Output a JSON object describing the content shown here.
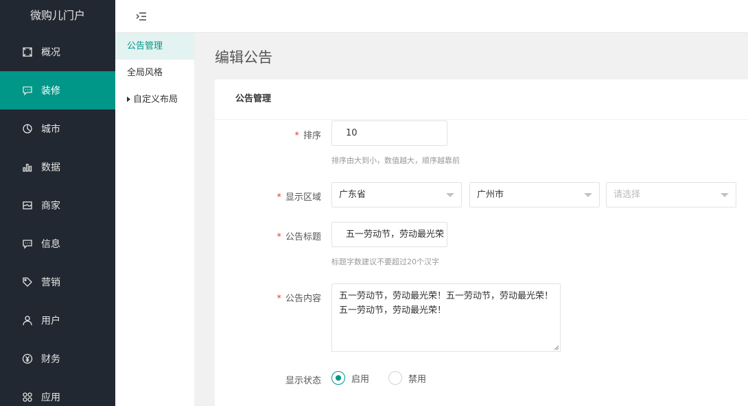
{
  "app": {
    "brand": "微购儿门户"
  },
  "sidebar": {
    "items": [
      {
        "label": "概况",
        "icon": "overview-icon"
      },
      {
        "label": "装修",
        "icon": "decorate-icon",
        "active": true
      },
      {
        "label": "城市",
        "icon": "city-icon"
      },
      {
        "label": "数据",
        "icon": "data-chart-icon"
      },
      {
        "label": "商家",
        "icon": "merchant-icon"
      },
      {
        "label": "信息",
        "icon": "message-icon"
      },
      {
        "label": "营销",
        "icon": "tag-icon"
      },
      {
        "label": "用户",
        "icon": "user-icon"
      },
      {
        "label": "财务",
        "icon": "yen-icon"
      },
      {
        "label": "应用",
        "icon": "apps-icon"
      }
    ]
  },
  "submenu": {
    "items": [
      {
        "label": "公告管理",
        "active": true
      },
      {
        "label": "全局风格"
      },
      {
        "label": "自定义布局"
      }
    ]
  },
  "page": {
    "title": "编辑公告"
  },
  "card": {
    "title": "公告管理"
  },
  "form": {
    "sort": {
      "label": "排序",
      "value": "10",
      "hint": "排序由大到小，数值越大，顺序越靠前"
    },
    "region": {
      "label": "显示区域",
      "province": "广东省",
      "city": "广州市",
      "district_placeholder": "请选择"
    },
    "title": {
      "label": "公告标题",
      "value": "五一劳动节，劳动最光荣",
      "hint": "标题字数建议不要超过20个汉字"
    },
    "content": {
      "label": "公告内容",
      "value": "五一劳动节，劳动最光荣！五一劳动节，劳动最光荣！五一劳动节，劳动最光荣！"
    },
    "status": {
      "label": "显示状态",
      "options": [
        "启用",
        "禁用"
      ],
      "selected": "启用"
    }
  },
  "colors": {
    "accent": "#009688",
    "sidebar_bg": "#222831",
    "required": "#e4393c"
  }
}
